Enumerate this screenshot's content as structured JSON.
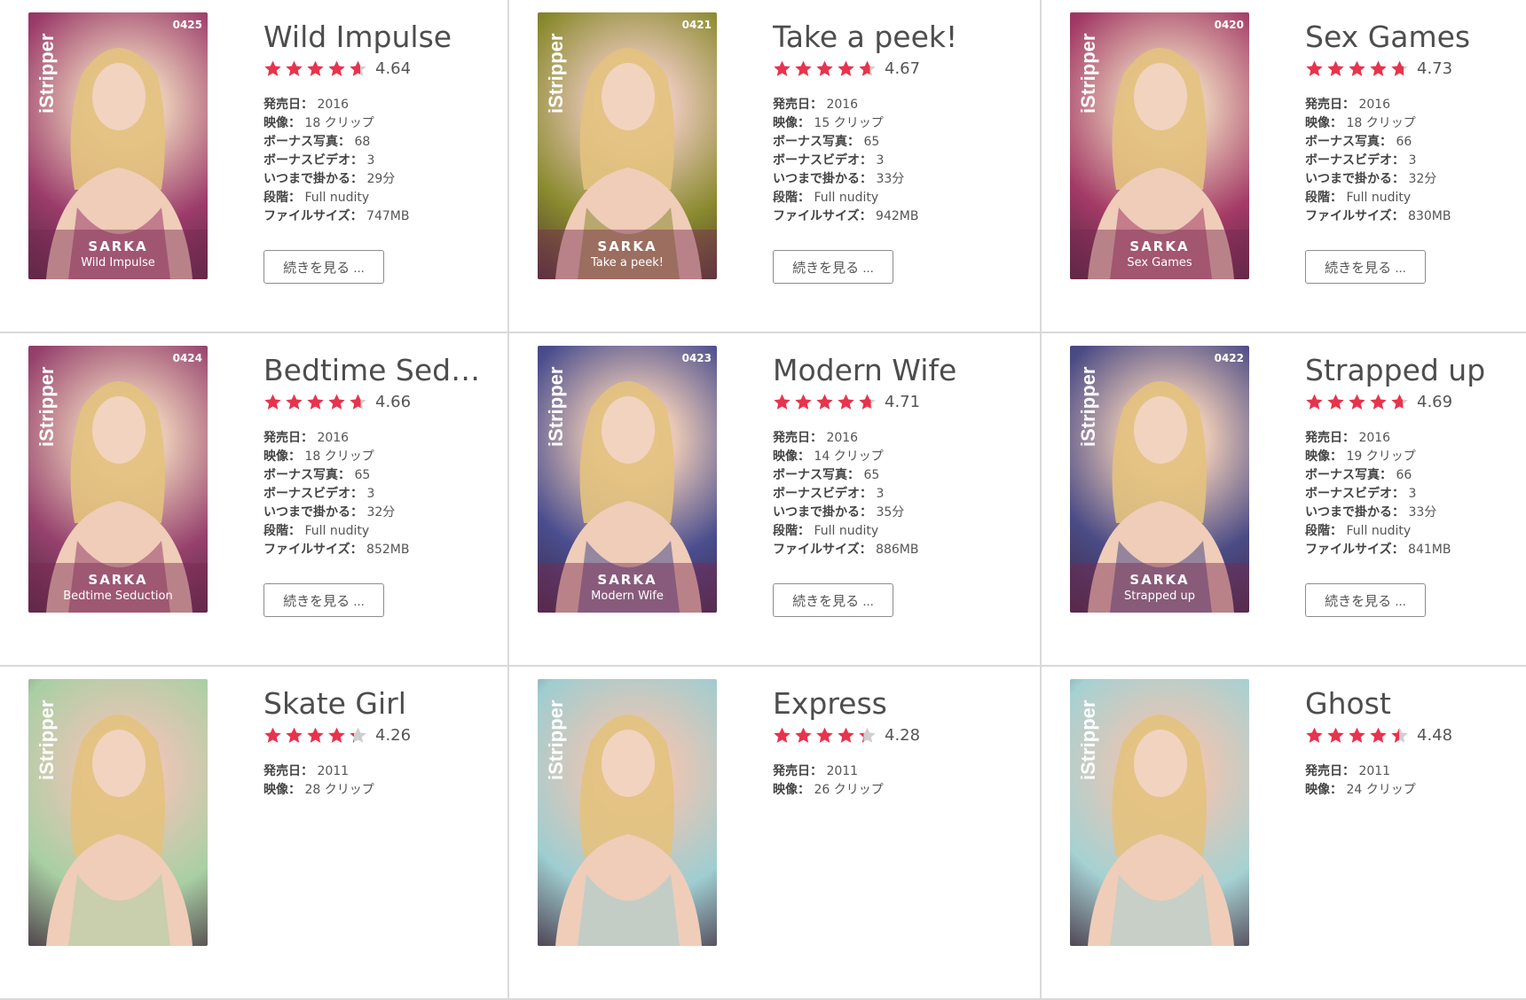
{
  "labels": {
    "release": "発売日：",
    "video": "映像：",
    "bonus_photos": "ボーナス写真：",
    "bonus_videos": "ボーナスビデオ：",
    "duration": "いつまで掛かる：",
    "level": "段階：",
    "file_size": "ファイルサイズ：",
    "more_button": "続きを見る ..."
  },
  "brand": "iStripper",
  "model": "SARKA",
  "items": [
    {
      "num": "0425",
      "title": "Wild Impulse",
      "card_caption": "Wild Impulse",
      "rating": "4.64",
      "release": "2016",
      "video": "18 クリップ",
      "bonus_photos": "68",
      "bonus_videos": "3",
      "duration": "29分",
      "level": "Full nudity",
      "file_size": "747MB",
      "theme": "#9b3b6a"
    },
    {
      "num": "0421",
      "title": "Take a peek!",
      "card_caption": "Take a peek!",
      "rating": "4.67",
      "release": "2016",
      "video": "15 クリップ",
      "bonus_photos": "65",
      "bonus_videos": "3",
      "duration": "33分",
      "level": "Full nudity",
      "file_size": "942MB",
      "theme": "#8a8a2f"
    },
    {
      "num": "0420",
      "title": "Sex Games",
      "card_caption": "Sex Games",
      "rating": "4.73",
      "release": "2016",
      "video": "18 クリップ",
      "bonus_photos": "66",
      "bonus_videos": "3",
      "duration": "32分",
      "level": "Full nudity",
      "file_size": "830MB",
      "theme": "#a33a66"
    },
    {
      "num": "0424",
      "title": "Bedtime Seduction",
      "card_caption": "Bedtime Seduction",
      "rating": "4.66",
      "release": "2016",
      "video": "18 クリップ",
      "bonus_photos": "65",
      "bonus_videos": "3",
      "duration": "32分",
      "level": "Full nudity",
      "file_size": "852MB",
      "theme": "#96416d"
    },
    {
      "num": "0423",
      "title": "Modern Wife",
      "card_caption": "Modern Wife",
      "rating": "4.71",
      "release": "2016",
      "video": "14 クリップ",
      "bonus_photos": "65",
      "bonus_videos": "3",
      "duration": "35分",
      "level": "Full nudity",
      "file_size": "886MB",
      "theme": "#4a4d8e"
    },
    {
      "num": "0422",
      "title": "Strapped up",
      "card_caption": "Strapped up",
      "rating": "4.69",
      "release": "2016",
      "video": "19 クリップ",
      "bonus_photos": "66",
      "bonus_videos": "3",
      "duration": "33分",
      "level": "Full nudity",
      "file_size": "841MB",
      "theme": "#4b4b85"
    },
    {
      "num": "",
      "title": "Skate Girl",
      "card_caption": "",
      "rating": "4.26",
      "release": "2011",
      "video": "28 クリップ",
      "bonus_photos": "",
      "bonus_videos": "",
      "duration": "",
      "level": "",
      "file_size": "",
      "theme": "#a9cfa4"
    },
    {
      "num": "",
      "title": "Express",
      "card_caption": "",
      "rating": "4.28",
      "release": "2011",
      "video": "26 クリップ",
      "bonus_photos": "",
      "bonus_videos": "",
      "duration": "",
      "level": "",
      "file_size": "",
      "theme": "#9fcdd0"
    },
    {
      "num": "",
      "title": "Ghost",
      "card_caption": "",
      "rating": "4.48",
      "release": "2011",
      "video": "24 クリップ",
      "bonus_photos": "",
      "bonus_videos": "",
      "duration": "",
      "level": "",
      "file_size": "",
      "theme": "#a6d1d2"
    }
  ],
  "colors": {
    "star": "#e8334d",
    "star_empty": "#cfcfcf",
    "border": "#d9d9d9"
  }
}
